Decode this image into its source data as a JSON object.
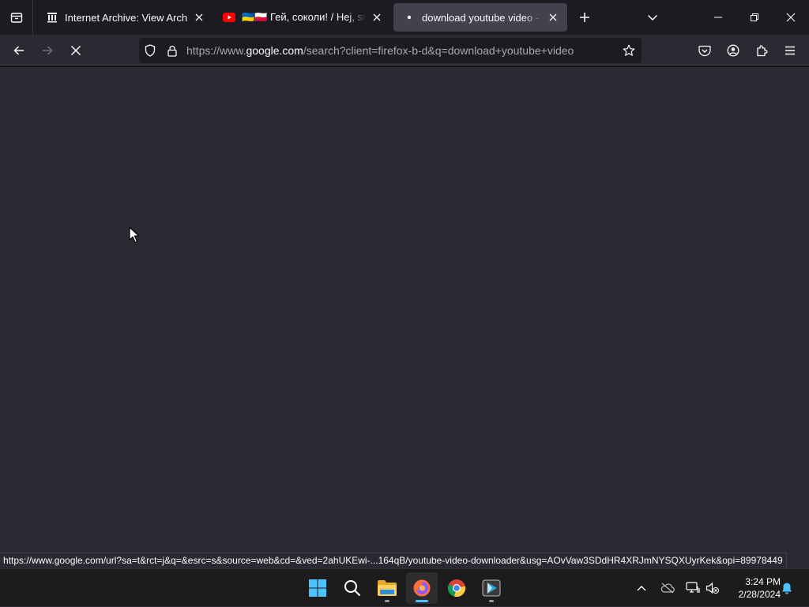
{
  "browser": {
    "tabs": [
      {
        "title": "Internet Archive: View Archive",
        "favicon": "archive-icon",
        "active": false
      },
      {
        "title": "🇺🇦🇵🇱 Гей, соколи! / Hej, sokoły",
        "favicon": "youtube-icon",
        "active": false
      },
      {
        "title": "download youtube video - Google Search",
        "favicon": "loading-dot-icon",
        "active": true
      }
    ],
    "url": {
      "prefix": "https://www.",
      "domain": "google.com",
      "path": "/search?client=firefox-b-d&q=download+youtube+video"
    },
    "status_url": "https://www.google.com/url?sa=t&rct=j&q=&esrc=s&source=web&cd=&ved=2ahUKEwi-...164qB/youtube-video-downloader&usg=AOvVaw3SDdHR4XRJmNYSQXUyrKek&opi=89978449",
    "colors": {
      "tab_bar": "#1c1b22",
      "toolbar": "#2b2a33",
      "active_tab": "#42414d"
    }
  },
  "taskbar": {
    "apps": [
      "start-button",
      "search-button",
      "file-explorer",
      "firefox",
      "chrome",
      "media-app"
    ],
    "clock": {
      "time": "3:24 PM",
      "date": "2/28/2024"
    },
    "accent": "#4cc2ff"
  }
}
